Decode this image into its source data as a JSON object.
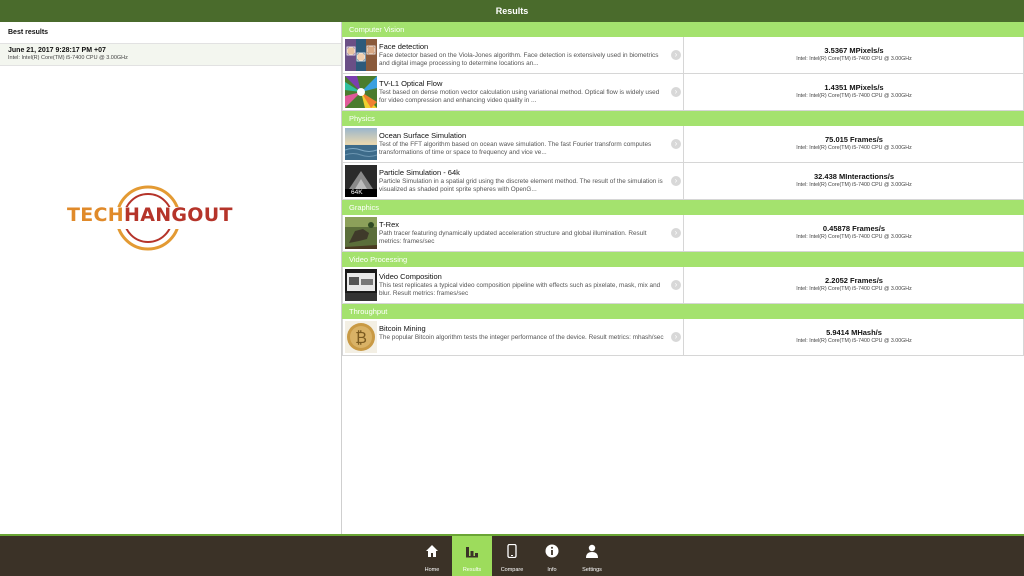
{
  "header": {
    "title": "Results"
  },
  "left_panel": {
    "heading": "Best results",
    "best": [
      {
        "date": "June 21, 2017 9:28:17 PM +07",
        "cpu": "Intel: Intel(R) Core(TM) i5-7400 CPU @ 3.00GHz"
      }
    ],
    "logo": {
      "part1": "TECH",
      "part2": "HANGOUT"
    }
  },
  "sections": [
    {
      "title": "Computer Vision",
      "tests": [
        {
          "name": "Face detection",
          "desc": "Face detector based on the Viola-Jones algorithm. Face detection is extensively used in biometrics and digital image processing to determine locations an...",
          "score": "3.5367 MPixels/s",
          "cpu": "Intel: Intel(R) Core(TM) i5-7400 CPU @ 3.00GHz",
          "thumb": "face-detection"
        },
        {
          "name": "TV-L1 Optical Flow",
          "desc": "Test based on dense motion vector calculation using variational method. Optical flow is widely used for video compression and enhancing video quality in ...",
          "score": "1.4351 MPixels/s",
          "cpu": "Intel: Intel(R) Core(TM) i5-7400 CPU @ 3.00GHz",
          "thumb": "optical-flow"
        }
      ]
    },
    {
      "title": "Physics",
      "tests": [
        {
          "name": "Ocean Surface Simulation",
          "desc": "Test of the FFT algorithm based on ocean wave simulation. The fast Fourier transform computes transformations of time or space to frequency and vice ve...",
          "score": "75.015 Frames/s",
          "cpu": "Intel: Intel(R) Core(TM) i5-7400 CPU @ 3.00GHz",
          "thumb": "ocean"
        },
        {
          "name": "Particle Simulation - 64k",
          "desc": "Particle Simulation in a spatial grid using the discrete element method. The result of the simulation is visualized as shaded point sprite spheres with OpenG...",
          "score": "32.438 MInteractions/s",
          "cpu": "Intel: Intel(R) Core(TM) i5-7400 CPU @ 3.00GHz",
          "thumb": "particles",
          "badge": "64K"
        }
      ]
    },
    {
      "title": "Graphics",
      "tests": [
        {
          "name": "T-Rex",
          "desc": "Path tracer featuring dynamically updated acceleration structure and global illumination. Result metrics: frames/sec",
          "score": "0.45878 Frames/s",
          "cpu": "Intel: Intel(R) Core(TM) i5-7400 CPU @ 3.00GHz",
          "thumb": "t-rex"
        }
      ]
    },
    {
      "title": "Video Processing",
      "tests": [
        {
          "name": "Video Composition",
          "desc": "This test replicates a typical video composition pipeline with effects such as pixelate, mask, mix and blur. Result metrics: frames/sec",
          "score": "2.2052 Frames/s",
          "cpu": "Intel: Intel(R) Core(TM) i5-7400 CPU @ 3.00GHz",
          "thumb": "video"
        }
      ]
    },
    {
      "title": "Throughput",
      "tests": [
        {
          "name": "Bitcoin Mining",
          "desc": "The popular Bitcoin algorithm tests the integer performance of the device. Result metrics: mhash/sec",
          "score": "5.9414 MHash/s",
          "cpu": "Intel: Intel(R) Core(TM) i5-7400 CPU @ 3.00GHz",
          "thumb": "bitcoin"
        }
      ]
    }
  ],
  "tabs": [
    {
      "label": "Home",
      "icon": "home-icon"
    },
    {
      "label": "Results",
      "icon": "bar-chart-icon",
      "active": true
    },
    {
      "label": "Compare",
      "icon": "phone-icon"
    },
    {
      "label": "Info",
      "icon": "info-icon"
    },
    {
      "label": "Settings",
      "icon": "user-icon"
    }
  ],
  "colors": {
    "header_bg": "#4a6b2c",
    "section_bg": "#a4e26e",
    "tabbar_bg": "#3b3227",
    "active_tab": "#9ddc5c"
  }
}
